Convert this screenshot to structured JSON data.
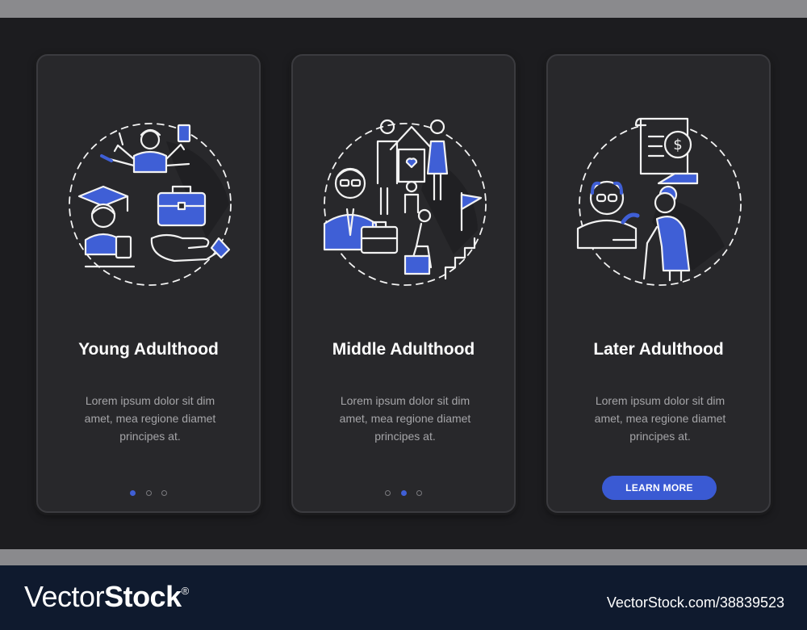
{
  "cards": [
    {
      "title": "Young Adulthood",
      "description": "Lorem ipsum dolor sit dim amet, mea regione diamet principes at.",
      "illustration_icons": [
        "multitasking-person-icon",
        "graduate-icon",
        "briefcase-icon",
        "helping-hand-icon"
      ],
      "pagination_active": 1
    },
    {
      "title": "Middle Adulthood",
      "description": "Lorem ipsum dolor sit dim amet, mea regione diamet principes at.",
      "illustration_icons": [
        "family-home-icon",
        "businessman-icon",
        "career-ladder-icon"
      ],
      "pagination_active": 2
    },
    {
      "title": "Later Adulthood",
      "description": "Lorem ipsum dolor sit dim amet, mea regione diamet principes at.",
      "illustration_icons": [
        "pension-document-icon",
        "elderly-man-icon",
        "elderly-woman-icon"
      ],
      "button_label": "LEARN MORE"
    }
  ],
  "pagination_total": 3,
  "colors": {
    "accent": "#3a5ad3",
    "card_background": "#28282b",
    "page_background": "#1c1c1f",
    "footer_background": "#0f1a2e"
  },
  "footer": {
    "brand_regular": "Vector",
    "brand_bold": "Stock",
    "brand_mark": "®",
    "image_id": "VectorStock.com/38839523"
  }
}
